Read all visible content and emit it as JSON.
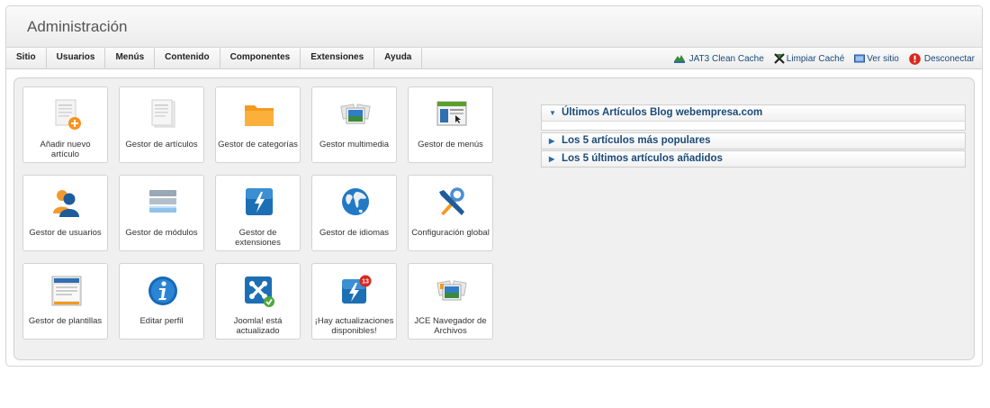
{
  "header": {
    "title": "Administración"
  },
  "menu": {
    "items": [
      "Sitio",
      "Usuarios",
      "Menús",
      "Contenido",
      "Componentes",
      "Extensiones",
      "Ayuda"
    ]
  },
  "right_links": {
    "jat3": "JAT3 Clean Cache",
    "clear_cache": "Limpiar Caché",
    "view_site": "Ver sitio",
    "logout": "Desconectar"
  },
  "tiles": [
    {
      "label": "Añadir nuevo artículo",
      "icon": "add-article-icon"
    },
    {
      "label": "Gestor de artículos",
      "icon": "article-manager-icon"
    },
    {
      "label": "Gestor de categorías",
      "icon": "folder-icon"
    },
    {
      "label": "Gestor multimedia",
      "icon": "media-icon"
    },
    {
      "label": "Gestor de menús",
      "icon": "menu-manager-icon"
    },
    {
      "label": "Gestor de usuarios",
      "icon": "users-icon"
    },
    {
      "label": "Gestor de módulos",
      "icon": "modules-icon"
    },
    {
      "label": "Gestor de extensiones",
      "icon": "extensions-icon"
    },
    {
      "label": "Gestor de idiomas",
      "icon": "globe-icon"
    },
    {
      "label": "Configuración global",
      "icon": "tools-icon"
    },
    {
      "label": "Gestor de plantillas",
      "icon": "templates-icon"
    },
    {
      "label": "Editar perfil",
      "icon": "info-icon"
    },
    {
      "label": "Joomla! está actualizado",
      "icon": "joomla-check-icon"
    },
    {
      "label": "¡Hay actualizaciones disponibles!",
      "icon": "updates-icon",
      "badge": "13"
    },
    {
      "label": "JCE Navegador de Archivos",
      "icon": "jce-browser-icon"
    }
  ],
  "accordion": [
    {
      "title": "Últimos Artículos Blog webempresa.com",
      "open": true
    },
    {
      "title": "Los 5 artículos más populares",
      "open": false
    },
    {
      "title": "Los 5 últimos artículos añadidos",
      "open": false
    }
  ],
  "colors": {
    "link": "#1a4a78",
    "accent_blue": "#2a6aa8",
    "orange": "#f7931e"
  }
}
